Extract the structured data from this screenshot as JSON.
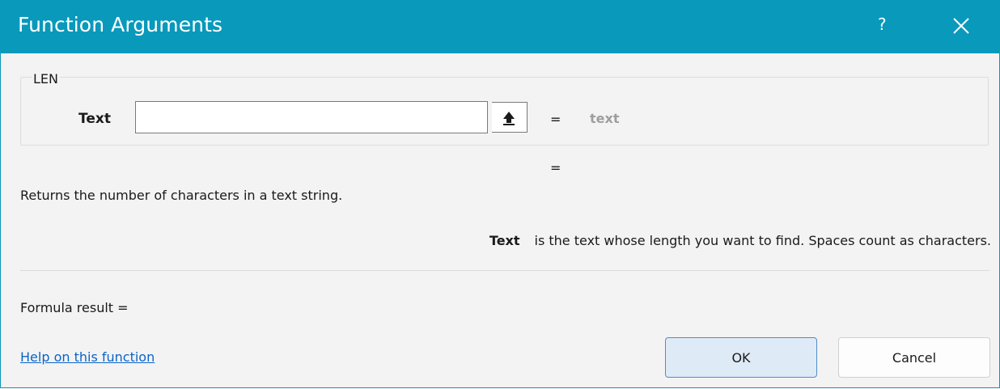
{
  "titlebar": {
    "title": "Function Arguments",
    "help": "?",
    "close_icon": "close-icon"
  },
  "function": {
    "name": "LEN"
  },
  "argument": {
    "label": "Text",
    "value": "",
    "collapse_icon": "collapse-dialog-icon",
    "equals": "=",
    "hint": "text"
  },
  "result_equals": "=",
  "description": "Returns the number of characters in a text string.",
  "argument_description": {
    "label": "Text",
    "text": "is the text whose length you want to find. Spaces count as characters."
  },
  "formula_result": "Formula result =",
  "help_link": "Help on this function",
  "buttons": {
    "ok": "OK",
    "cancel": "Cancel"
  },
  "colors": {
    "titlebar": "#0899bb",
    "link": "#0a64c8",
    "ok_border": "#4d8ec9",
    "hint": "#9e9e9e"
  }
}
